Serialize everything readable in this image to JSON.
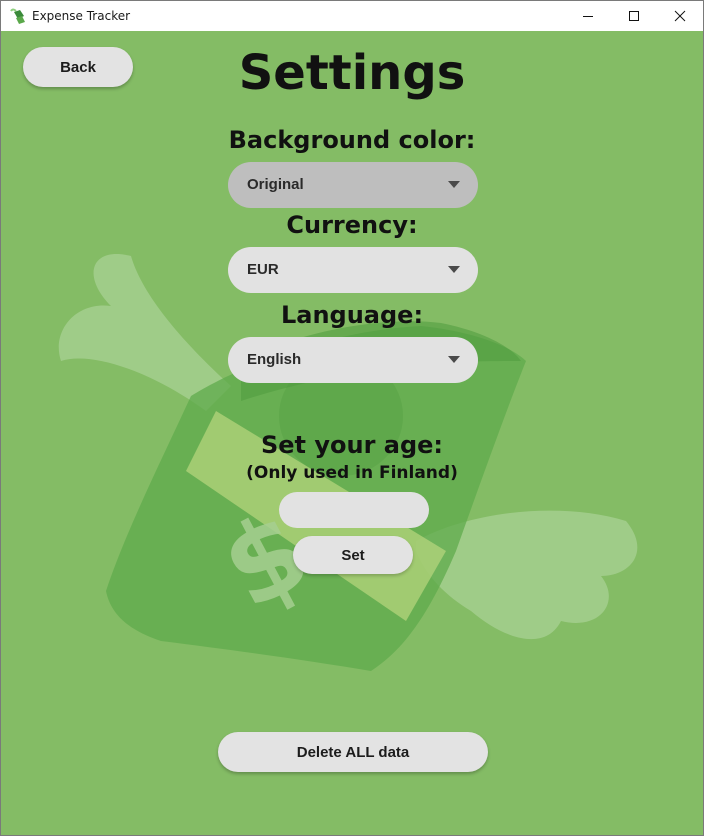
{
  "window": {
    "title": "Expense Tracker",
    "icon": "flying-money-icon",
    "controls": [
      "minimize-icon",
      "maximize-icon",
      "close-icon"
    ]
  },
  "colors": {
    "background": "#84bc65",
    "button": "#e3e3e3",
    "dropdown_active": "#bebebe"
  },
  "header": {
    "back_label": "Back",
    "title": "Settings"
  },
  "settings": {
    "background_color": {
      "label": "Background color:",
      "value": "Original"
    },
    "currency": {
      "label": "Currency:",
      "value": "EUR"
    },
    "language": {
      "label": "Language:",
      "value": "English"
    },
    "age": {
      "label": "Set your age:",
      "note": "(Only used in Finland)",
      "value": "",
      "set_label": "Set"
    }
  },
  "footer": {
    "delete_label": "Delete ALL data"
  }
}
